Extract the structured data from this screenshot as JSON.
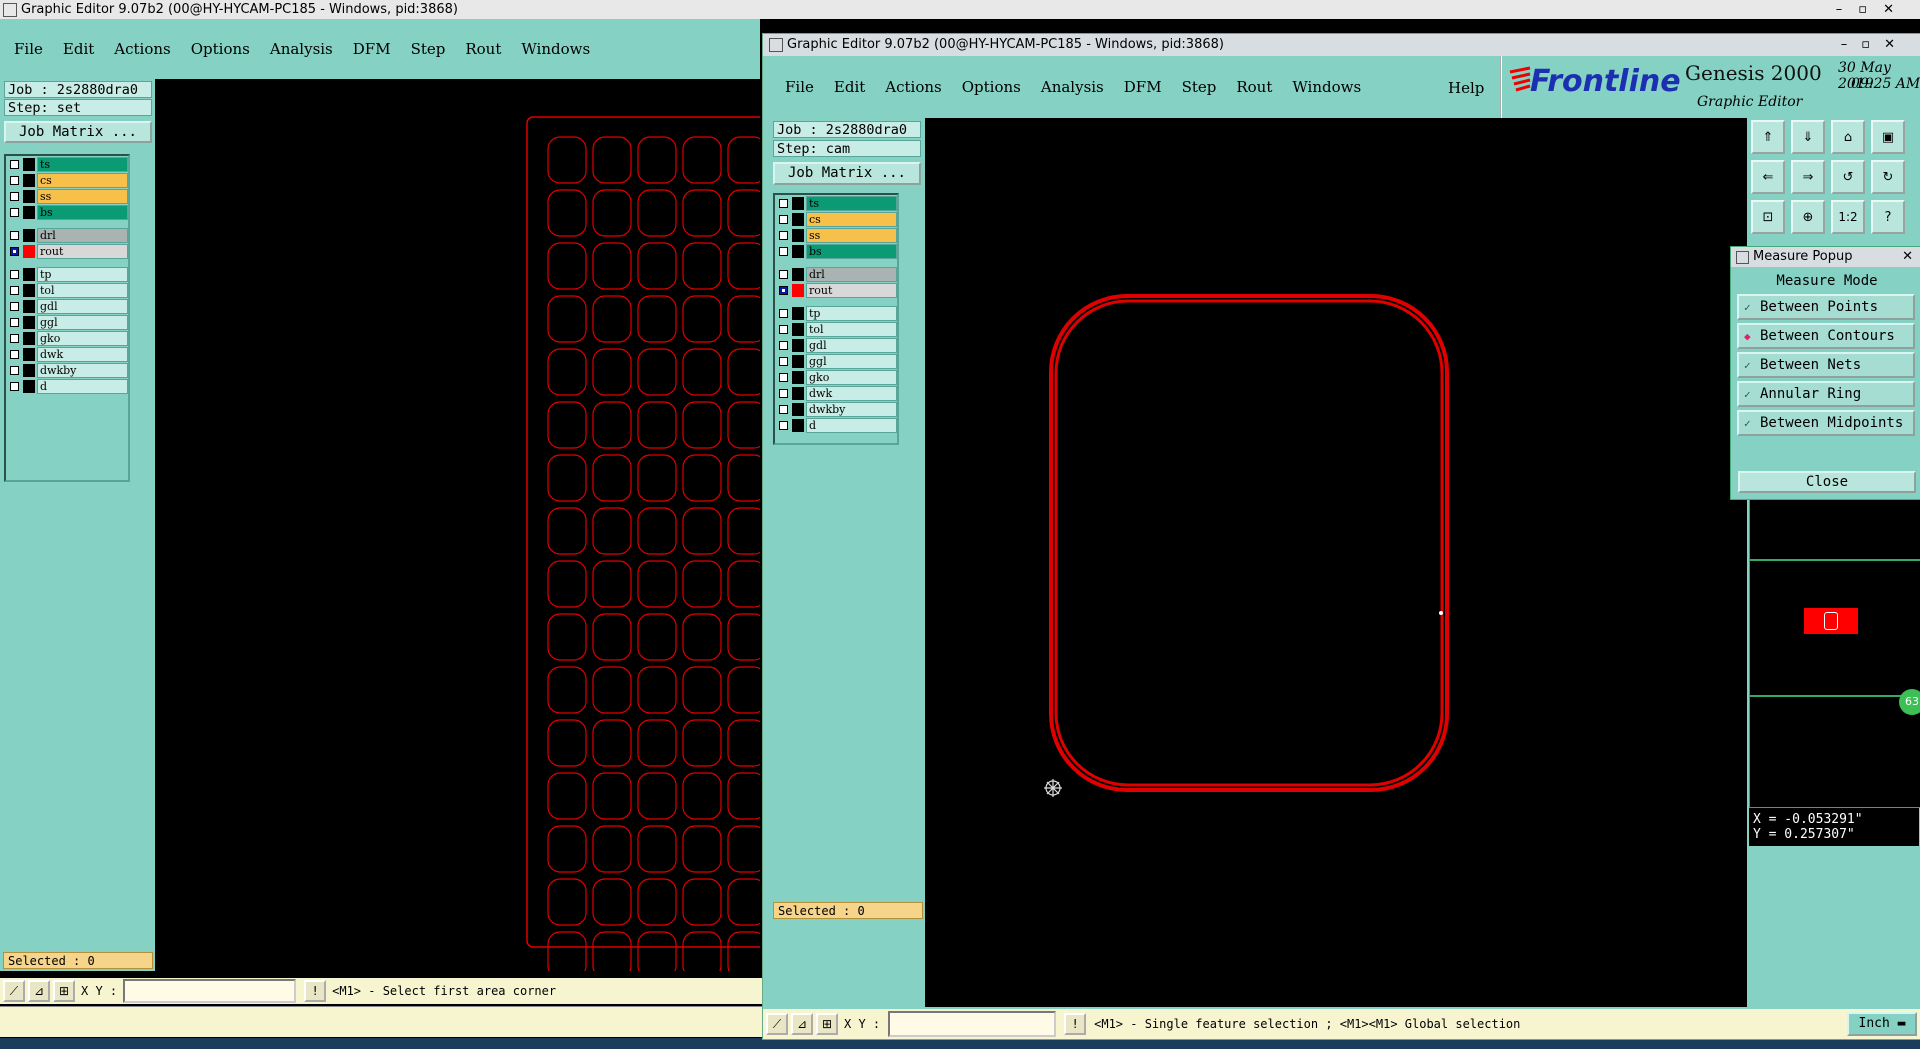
{
  "back_window": {
    "title": "Graphic Editor 9.07b2 (00@HY-HYCAM-PC185 - Windows, pid:3868)",
    "menu": [
      "File",
      "Edit",
      "Actions",
      "Options",
      "Analysis",
      "DFM",
      "Step",
      "Rout",
      "Windows"
    ],
    "job": "Job : 2s2880dra0",
    "step": "Step: set",
    "job_matrix": "Job Matrix ...",
    "selected": "Selected : 0",
    "xy_label": "X Y :",
    "status_msg": "<M1> - Select first area corner"
  },
  "front_window": {
    "title": "Graphic Editor 9.07b2 (00@HY-HYCAM-PC185 - Windows, pid:3868)",
    "menu": [
      "File",
      "Edit",
      "Actions",
      "Options",
      "Analysis",
      "DFM",
      "Step",
      "Rout",
      "Windows"
    ],
    "help": "Help",
    "job": "Job : 2s2880dra0",
    "step": "Step: cam",
    "job_matrix": "Job Matrix ...",
    "selected": "Selected : 0",
    "xy_label": "X Y :",
    "status_msg": "<M1> - Single feature selection ; <M1><M1> Global selection",
    "unit": "Inch",
    "coord_x": "X = -0.053291\"",
    "coord_y": "Y = 0.257307\"",
    "brand": {
      "logo": "Frontline",
      "product": "Genesis 2000",
      "subtitle": "Graphic Editor",
      "date": "30 May 2019",
      "time": "09:25 AM"
    },
    "tools": [
      "upload-icon",
      "download-icon",
      "home-icon",
      "window-icon",
      "arrow-left-icon",
      "arrow-right-icon",
      "rotate-icon",
      "redo-icon",
      "zoom-fit-icon",
      "zoom-home-icon",
      "ratio-icon",
      "help-icon"
    ],
    "tool_text": {
      "ratio": "1:2",
      "help": "?"
    },
    "side_badge": "63"
  },
  "layers": [
    {
      "name": "ts",
      "color": "#0a9a74",
      "group": 1
    },
    {
      "name": "cs",
      "color": "#f6c04a",
      "group": 1
    },
    {
      "name": "ss",
      "color": "#f6c04a",
      "group": 1
    },
    {
      "name": "bs",
      "color": "#0a9a74",
      "group": 1
    },
    {
      "name": "drl",
      "color": "#a9b4b2",
      "group": 2
    },
    {
      "name": "rout",
      "color": "#d8d8d8",
      "group": 2,
      "active": true
    },
    {
      "name": "tp",
      "color": "#c8ece6",
      "group": 3
    },
    {
      "name": "tol",
      "color": "#c8ece6",
      "group": 3
    },
    {
      "name": "gdl",
      "color": "#c8ece6",
      "group": 3
    },
    {
      "name": "ggl",
      "color": "#c8ece6",
      "group": 3
    },
    {
      "name": "gko",
      "color": "#c8ece6",
      "group": 3
    },
    {
      "name": "dwk",
      "color": "#c8ece6",
      "group": 3
    },
    {
      "name": "dwkby",
      "color": "#c8ece6",
      "group": 3
    },
    {
      "name": "d",
      "color": "#c8ece6",
      "group": 3
    }
  ],
  "measure_popup": {
    "title": "Measure Popup",
    "header": "Measure Mode",
    "options": [
      {
        "label": "Between Points",
        "selected": false
      },
      {
        "label": "Between Contours",
        "selected": true
      },
      {
        "label": "Between Nets",
        "selected": false
      },
      {
        "label": "Annular Ring",
        "selected": false
      },
      {
        "label": "Between Midpoints",
        "selected": false
      }
    ],
    "close": "Close"
  },
  "colors": {
    "panel": "#85d1c4",
    "selected_bg": "#f6d48a",
    "board_red": "#e00000",
    "accent": "#ff0000"
  }
}
